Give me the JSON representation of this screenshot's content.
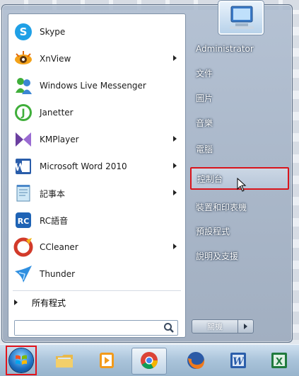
{
  "programs": [
    {
      "label": "Skype",
      "icon": "skype-icon",
      "submenu": false
    },
    {
      "label": "XnView",
      "icon": "xnview-icon",
      "submenu": true
    },
    {
      "label": "Windows Live Messenger",
      "icon": "messenger-icon",
      "submenu": false
    },
    {
      "label": "Janetter",
      "icon": "janetter-icon",
      "submenu": false
    },
    {
      "label": "KMPlayer",
      "icon": "kmplayer-icon",
      "submenu": true
    },
    {
      "label": "Microsoft Word 2010",
      "icon": "word-icon",
      "submenu": true
    },
    {
      "label": "記事本",
      "icon": "notepad-icon",
      "submenu": true
    },
    {
      "label": "RC語音",
      "icon": "rc-icon",
      "submenu": false
    },
    {
      "label": "CCleaner",
      "icon": "ccleaner-icon",
      "submenu": true
    },
    {
      "label": "Thunder",
      "icon": "thunder-icon",
      "submenu": false
    }
  ],
  "all_programs": "所有程式",
  "search": {
    "value": "",
    "placeholder": ""
  },
  "right_items": [
    {
      "label": "Administrator",
      "highlight": false
    },
    {
      "label": "文件",
      "highlight": false
    },
    {
      "label": "圖片",
      "highlight": false
    },
    {
      "label": "音樂",
      "highlight": false
    },
    {
      "label": "電腦",
      "highlight": false
    },
    {
      "label": "控制台",
      "highlight": true
    },
    {
      "label": "裝置和印表機",
      "highlight": false
    },
    {
      "label": "預設程式",
      "highlight": false
    },
    {
      "label": "說明及支援",
      "highlight": false
    }
  ],
  "shutdown_label": "關機",
  "taskbar_icons": [
    "explorer-icon",
    "media-player-icon",
    "chrome-icon",
    "firefox-icon",
    "word-icon",
    "excel-icon"
  ],
  "colors": {
    "highlight_border": "#d9141c",
    "accent": "#1b6fc2"
  }
}
